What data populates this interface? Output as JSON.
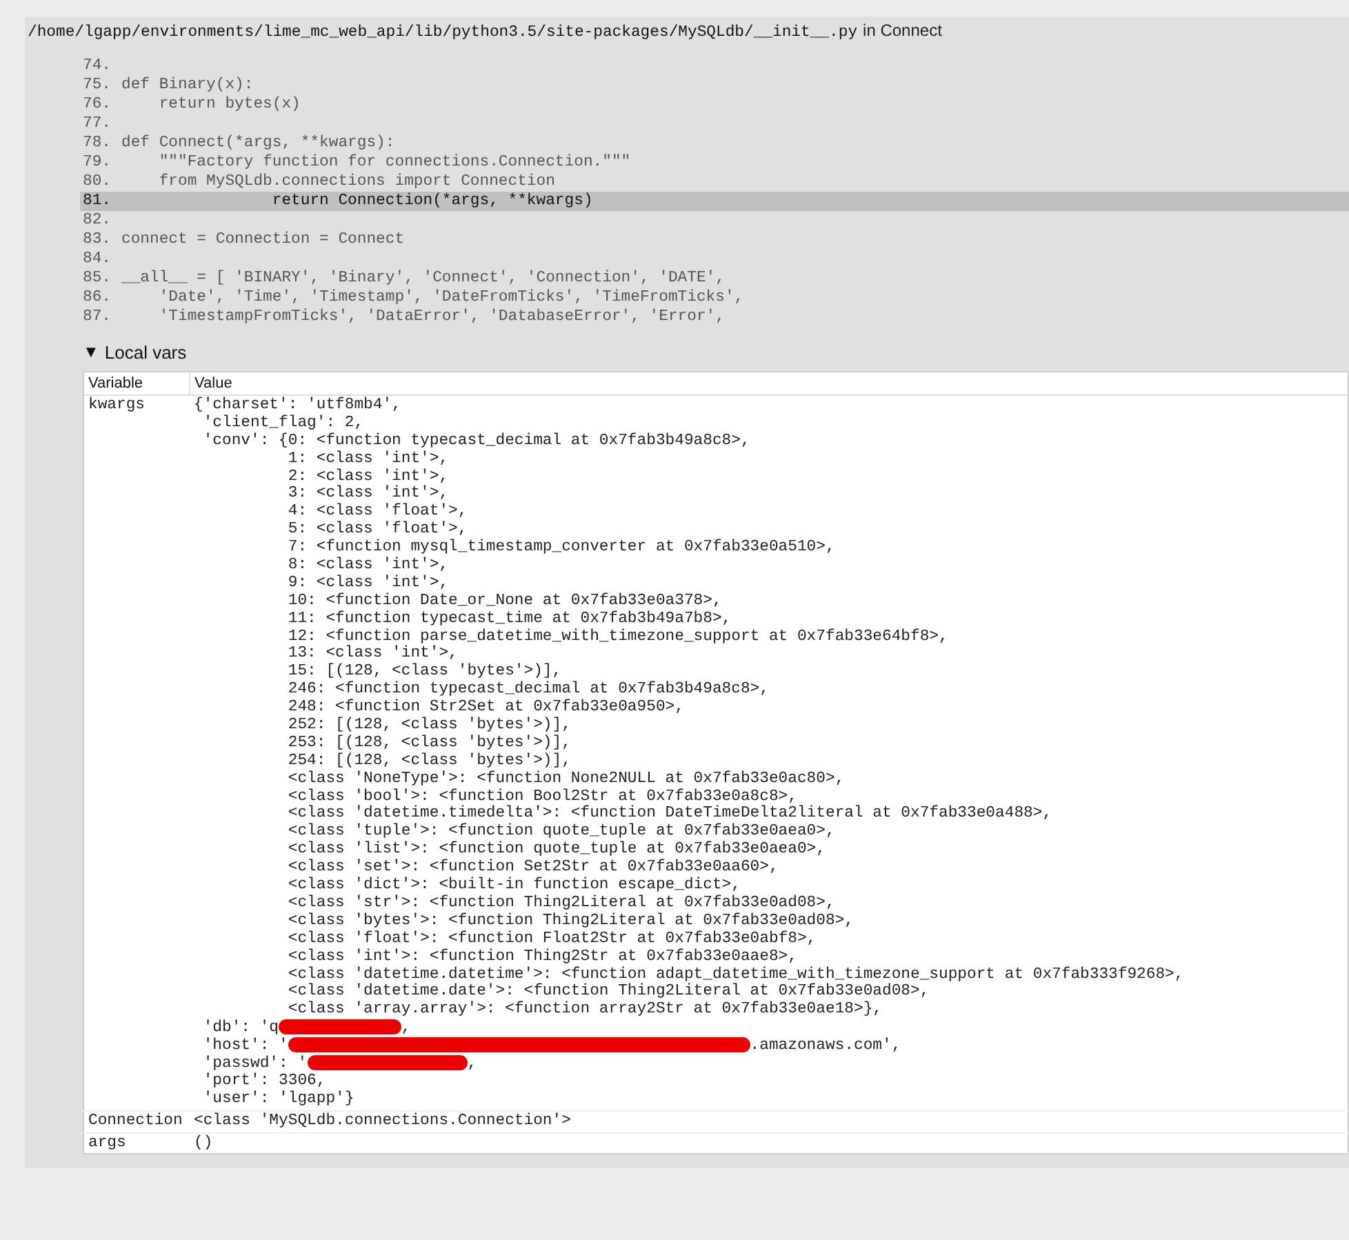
{
  "frame": {
    "file_path": "/home/lgapp/environments/lime_mc_web_api/lib/python3.5/site-packages/MySQLdb/__init__.py",
    "location": "in Connect"
  },
  "context_lines": [
    {
      "number": "74.",
      "selected": false
    },
    {
      "number": "75.",
      "code": "def Binary(x):",
      "selected": false
    },
    {
      "number": "76.",
      "code": "    return bytes(x)",
      "selected": false
    },
    {
      "number": "77.",
      "selected": false
    },
    {
      "number": "78.",
      "code": "def Connect(*args, **kwargs):",
      "selected": false
    },
    {
      "number": "79.",
      "code": "    \"\"\"Factory function for connections.Connection.\"\"\"",
      "selected": false
    },
    {
      "number": "80.",
      "code": "    from MySQLdb.connections import Connection",
      "selected": false
    },
    {
      "number": "81.",
      "code": "                return Connection(*args, **kwargs)",
      "selected": true
    },
    {
      "number": "82.",
      "selected": false
    },
    {
      "number": "83.",
      "code": "connect = Connection = Connect",
      "selected": false
    },
    {
      "number": "84.",
      "selected": false
    },
    {
      "number": "85.",
      "code": "__all__ = [ 'BINARY', 'Binary', 'Connect', 'Connection', 'DATE',",
      "selected": false
    },
    {
      "number": "86.",
      "code": "    'Date', 'Time', 'Timestamp', 'DateFromTicks', 'TimeFromTicks',",
      "selected": false
    },
    {
      "number": "87.",
      "code": "    'TimestampFromTicks', 'DataError', 'DatabaseError', 'Error',",
      "selected": false
    }
  ],
  "local_vars": {
    "toggle": "▼",
    "title": "Local vars",
    "columns": [
      "Variable",
      "Value"
    ],
    "rows": [
      {
        "variable": "kwargs",
        "lines": [
          {
            "kind": "text",
            "text": "{'charset': 'utf8mb4',"
          },
          {
            "kind": "text",
            "text": " 'client_flag': 2,"
          },
          {
            "kind": "text",
            "text": " 'conv': {0: <function typecast_decimal at 0x7fab3b49a8c8>,"
          },
          {
            "kind": "text",
            "text": "          1: <class 'int'>,"
          },
          {
            "kind": "text",
            "text": "          2: <class 'int'>,"
          },
          {
            "kind": "text",
            "text": "          3: <class 'int'>,"
          },
          {
            "kind": "text",
            "text": "          4: <class 'float'>,"
          },
          {
            "kind": "text",
            "text": "          5: <class 'float'>,"
          },
          {
            "kind": "text",
            "text": "          7: <function mysql_timestamp_converter at 0x7fab33e0a510>,"
          },
          {
            "kind": "text",
            "text": "          8: <class 'int'>,"
          },
          {
            "kind": "text",
            "text": "          9: <class 'int'>,"
          },
          {
            "kind": "text",
            "text": "          10: <function Date_or_None at 0x7fab33e0a378>,"
          },
          {
            "kind": "text",
            "text": "          11: <function typecast_time at 0x7fab3b49a7b8>,"
          },
          {
            "kind": "text",
            "text": "          12: <function parse_datetime_with_timezone_support at 0x7fab33e64bf8>,"
          },
          {
            "kind": "text",
            "text": "          13: <class 'int'>,"
          },
          {
            "kind": "text",
            "text": "          15: [(128, <class 'bytes'>)],"
          },
          {
            "kind": "text",
            "text": "          246: <function typecast_decimal at 0x7fab3b49a8c8>,"
          },
          {
            "kind": "text",
            "text": "          248: <function Str2Set at 0x7fab33e0a950>,"
          },
          {
            "kind": "text",
            "text": "          252: [(128, <class 'bytes'>)],"
          },
          {
            "kind": "text",
            "text": "          253: [(128, <class 'bytes'>)],"
          },
          {
            "kind": "text",
            "text": "          254: [(128, <class 'bytes'>)],"
          },
          {
            "kind": "text",
            "text": "          <class 'NoneType'>: <function None2NULL at 0x7fab33e0ac80>,"
          },
          {
            "kind": "text",
            "text": "          <class 'bool'>: <function Bool2Str at 0x7fab33e0a8c8>,"
          },
          {
            "kind": "text",
            "text": "          <class 'datetime.timedelta'>: <function DateTimeDelta2literal at 0x7fab33e0a488>,"
          },
          {
            "kind": "text",
            "text": "          <class 'tuple'>: <function quote_tuple at 0x7fab33e0aea0>,"
          },
          {
            "kind": "text",
            "text": "          <class 'list'>: <function quote_tuple at 0x7fab33e0aea0>,"
          },
          {
            "kind": "text",
            "text": "          <class 'set'>: <function Set2Str at 0x7fab33e0aa60>,"
          },
          {
            "kind": "text",
            "text": "          <class 'dict'>: <built-in function escape_dict>,"
          },
          {
            "kind": "text",
            "text": "          <class 'str'>: <function Thing2Literal at 0x7fab33e0ad08>,"
          },
          {
            "kind": "text",
            "text": "          <class 'bytes'>: <function Thing2Literal at 0x7fab33e0ad08>,"
          },
          {
            "kind": "text",
            "text": "          <class 'float'>: <function Float2Str at 0x7fab33e0abf8>,"
          },
          {
            "kind": "text",
            "text": "          <class 'int'>: <function Thing2Str at 0x7fab33e0aae8>,"
          },
          {
            "kind": "text",
            "text": "          <class 'datetime.datetime'>: <function adapt_datetime_with_timezone_support at 0x7fab333f9268>,"
          },
          {
            "kind": "text",
            "text": "          <class 'datetime.date'>: <function Thing2Literal at 0x7fab33e0ad08>,"
          },
          {
            "kind": "text",
            "text": "          <class 'array.array'>: <function array2Str at 0x7fab33e0ae18>},"
          },
          {
            "kind": "redacted",
            "before": " 'db': 'q",
            "after": ","
          },
          {
            "kind": "redacted",
            "before": " 'host': '",
            "after": ".amazonaws.com',"
          },
          {
            "kind": "redacted",
            "before": " 'passwd': '",
            "after": ","
          },
          {
            "kind": "text",
            "text": " 'port': 3306,"
          },
          {
            "kind": "text",
            "text": " 'user': 'lgapp'}"
          }
        ]
      },
      {
        "variable": "Connection",
        "lines": [
          {
            "kind": "text",
            "text": "<class 'MySQLdb.connections.Connection'>"
          }
        ]
      },
      {
        "variable": "args",
        "lines": [
          {
            "kind": "text",
            "text": "()"
          }
        ]
      }
    ]
  }
}
